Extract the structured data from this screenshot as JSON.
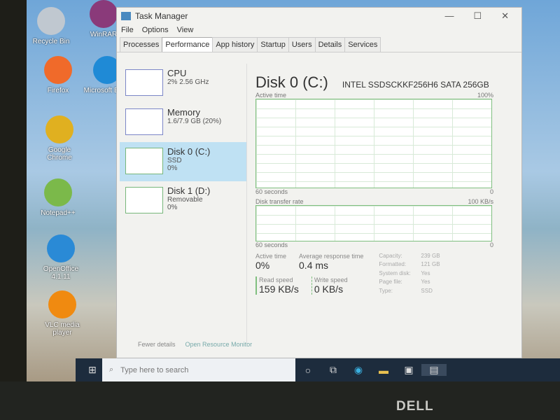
{
  "desktop": {
    "icons": [
      {
        "label": "Recycle Bin",
        "color": "#c0c8d0"
      },
      {
        "label": "WinRAR",
        "color": "#8a3a7a"
      },
      {
        "label": "Firefox",
        "color": "#f06a2a"
      },
      {
        "label": "Microsoft Edge",
        "color": "#1f8ad6"
      },
      {
        "label": "Google Chrome",
        "color": "#e0b020"
      },
      {
        "label": "Notepad++",
        "color": "#7bb94a"
      },
      {
        "label": "OpenOffice 4.1.11",
        "color": "#2a8ad6"
      },
      {
        "label": "VLC media player",
        "color": "#f08a10"
      }
    ]
  },
  "window": {
    "title": "Task Manager",
    "minimize": "—",
    "maximize": "☐",
    "close": "✕"
  },
  "menu": [
    "File",
    "Options",
    "View"
  ],
  "tabs": [
    "Processes",
    "Performance",
    "App history",
    "Startup",
    "Users",
    "Details",
    "Services"
  ],
  "active_tab": "Performance",
  "sidebar": [
    {
      "name": "CPU",
      "line1": "2% 2.56 GHz",
      "line2": ""
    },
    {
      "name": "Memory",
      "line1": "1.6/7.9 GB (20%)",
      "line2": ""
    },
    {
      "name": "Disk 0 (C:)",
      "line1": "SSD",
      "line2": "0%"
    },
    {
      "name": "Disk 1 (D:)",
      "line1": "Removable",
      "line2": "0%"
    }
  ],
  "main": {
    "title": "Disk 0 (C:)",
    "model": "INTEL SSDSCKKF256H6 SATA 256GB",
    "graph1": {
      "label": "Active time",
      "max": "100%",
      "xleft": "60 seconds",
      "xright": "0"
    },
    "graph2": {
      "label": "Disk transfer rate",
      "max": "100 KB/s",
      "xleft": "60 seconds",
      "xright": "0"
    },
    "stats": {
      "active_time_label": "Active time",
      "active_time": "0%",
      "resp_label": "Average response time",
      "resp": "0.4 ms",
      "read_label": "Read speed",
      "read": "159 KB/s",
      "write_label": "Write speed",
      "write": "0 KB/s"
    },
    "props": [
      [
        "Capacity:",
        "239 GB"
      ],
      [
        "Formatted:",
        "121 GB"
      ],
      [
        "System disk:",
        "Yes"
      ],
      [
        "Page file:",
        "Yes"
      ],
      [
        "Type:",
        "SSD"
      ]
    ]
  },
  "footer": {
    "fewer": "Fewer details",
    "monitor": "Open Resource Monitor"
  },
  "taskbar": {
    "search_placeholder": "Type here to search"
  },
  "brand": "DELL"
}
